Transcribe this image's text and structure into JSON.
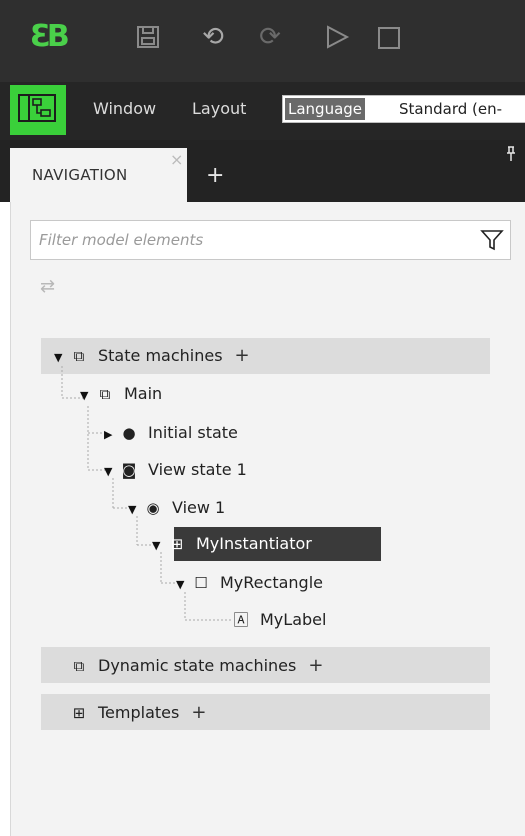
{
  "toolbar": {
    "logo": "ƐB",
    "save_icon": "save-icon",
    "undo_icon": "undo-icon",
    "redo_icon": "redo-icon",
    "play_icon": "play-icon",
    "stop_icon": "stop-icon"
  },
  "menu": {
    "window": "Window",
    "layout": "Layout",
    "language_label": "Language",
    "language_value": "Standard (en-"
  },
  "panel": {
    "tab_label": "NAVIGATION",
    "close_glyph": "×",
    "add_glyph": "+",
    "pin_glyph": "⍩"
  },
  "filter": {
    "placeholder": "Filter model elements",
    "value": ""
  },
  "tree": {
    "state_machines": "State machines",
    "main": "Main",
    "initial_state": "Initial state",
    "view_state": "View state 1",
    "view": "View 1",
    "instantiator": "MyInstantiator",
    "rectangle": "MyRectangle",
    "label": "MyLabel",
    "dynamic_state_machines": "Dynamic state machines",
    "templates": "Templates",
    "plus": "+"
  },
  "colors": {
    "accent_green": "#3ad03a",
    "selection": "#3a3a3a"
  }
}
